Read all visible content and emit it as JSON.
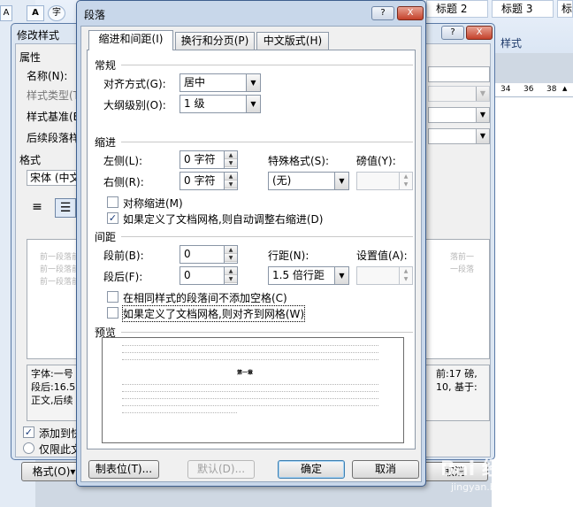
{
  "ribbon": {
    "tiles": [
      "标题 2",
      "标题 3",
      "标"
    ],
    "font_buttons": [
      "A",
      "A"
    ],
    "style_pane_label": "样式",
    "ruler_ticks": [
      "34",
      "36",
      "38"
    ]
  },
  "modify_dialog": {
    "title": "修改样式",
    "help": "?",
    "close": "X",
    "group_properties": "属性",
    "name_label": "名称(N):",
    "style_type_label": "样式类型(T):",
    "style_based_label": "样式基准(B):",
    "next_style_label": "后续段落样式(S):",
    "format_group": "格式",
    "font_value": "宋体 (中文",
    "preview_ghost_1": "前一段落前一段落前一段落前一段落",
    "preview_ghost_right": "落前一",
    "preview_ghost_right2": "一段落",
    "desc_left": "字体:一号\n段后:16.5\n正文,后续",
    "desc_right": "前:17 磅,\n10, 基于:",
    "add_quick_label": "添加到快速",
    "only_this_doc_label": "仅限此文档",
    "format_button": "格式(O)▾",
    "cancel_button": "取消"
  },
  "para_dialog": {
    "title": "段落",
    "help": "?",
    "close": "X",
    "tabs": [
      "缩进和间距(I)",
      "换行和分页(P)",
      "中文版式(H)"
    ],
    "general": {
      "section": "常规",
      "alignment_label": "对齐方式(G):",
      "alignment_value": "居中",
      "outline_label": "大纲级别(O):",
      "outline_value": "1 级"
    },
    "indent": {
      "section": "缩进",
      "left_label": "左侧(L):",
      "left_value": "0 字符",
      "right_label": "右侧(R):",
      "right_value": "0 字符",
      "special_label": "特殊格式(S):",
      "special_value": "(无)",
      "by_label": "磅值(Y):",
      "mirror_label": "对称缩进(M)",
      "mirror_checked": false,
      "auto_right_label": "如果定义了文档网格,则自动调整右缩进(D)",
      "auto_right_checked": true
    },
    "spacing": {
      "section": "间距",
      "before_label": "段前(B):",
      "before_value": "0",
      "after_label": "段后(F):",
      "after_value": "0",
      "line_label": "行距(N):",
      "line_value": "1.5 倍行距",
      "at_label": "设置值(A):",
      "no_space_label": "在相同样式的段落间不添加空格(C)",
      "no_space_checked": false,
      "snap_grid_label": "如果定义了文档网格,则对齐到网格(W)",
      "snap_grid_checked": false
    },
    "preview": {
      "section": "预览",
      "sample_text": "第一章"
    },
    "buttons": {
      "tabs": "制表位(T)...",
      "default": "默认(D)...",
      "ok": "确定",
      "cancel": "取消"
    }
  },
  "watermark": {
    "main": "Bai 经验",
    "sub": "jingyan.baidu.com"
  }
}
